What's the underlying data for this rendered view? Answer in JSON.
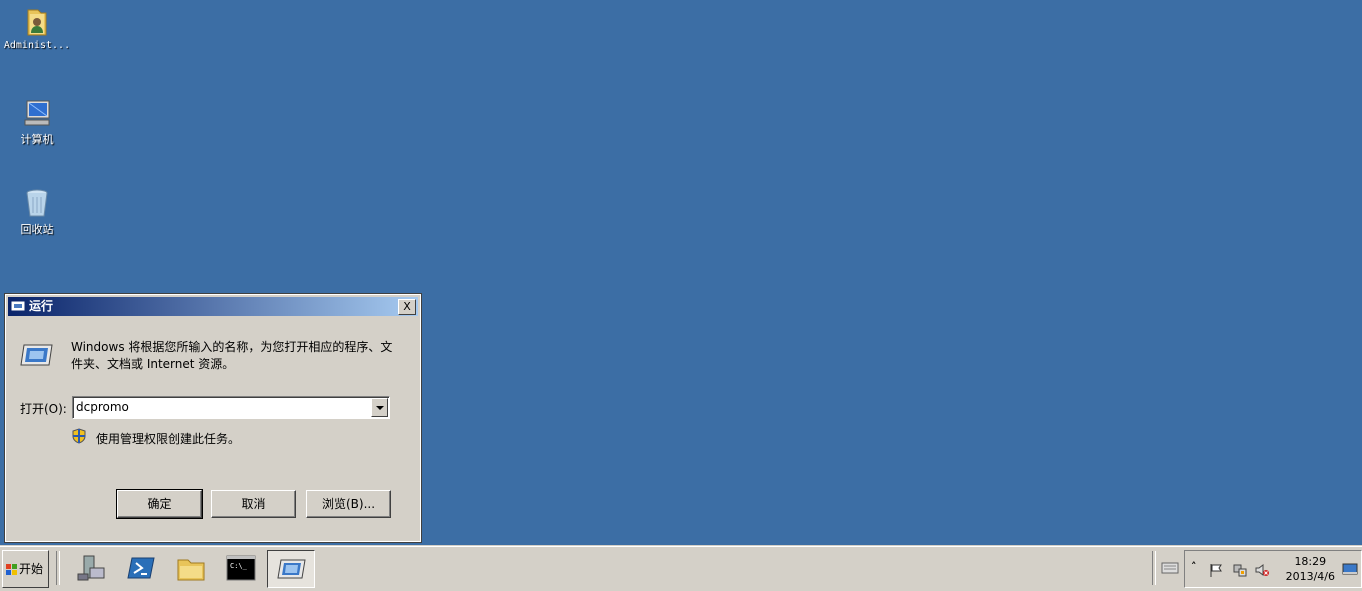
{
  "desktop": {
    "icons": [
      {
        "label": "Administ...",
        "icon": "user-folder-icon"
      },
      {
        "label": "计算机",
        "icon": "computer-icon"
      },
      {
        "label": "回收站",
        "icon": "recycle-bin-icon"
      }
    ]
  },
  "run_dialog": {
    "title": "运行",
    "close_label": "X",
    "description": "Windows 将根据您所输入的名称，为您打开相应的程序、文件夹、文档或 Internet 资源。",
    "open_label": "打开(O):",
    "input_value": "dcpromo",
    "admin_note": "使用管理权限创建此任务。",
    "buttons": {
      "ok": "确定",
      "cancel": "取消",
      "browse": "浏览(B)..."
    }
  },
  "taskbar": {
    "start_label": "开始",
    "pinned": [
      "server-manager-icon",
      "powershell-icon",
      "explorer-icon",
      "cmd-icon",
      "run-icon"
    ],
    "cmd_text": "C:\\_",
    "clock": {
      "time": "18:29",
      "date": "2013/4/6"
    }
  },
  "colors": {
    "desktop": "#3c6ea5",
    "title_start": "#0a246a",
    "title_end": "#a6caf0",
    "chrome": "#d4d0c8"
  }
}
